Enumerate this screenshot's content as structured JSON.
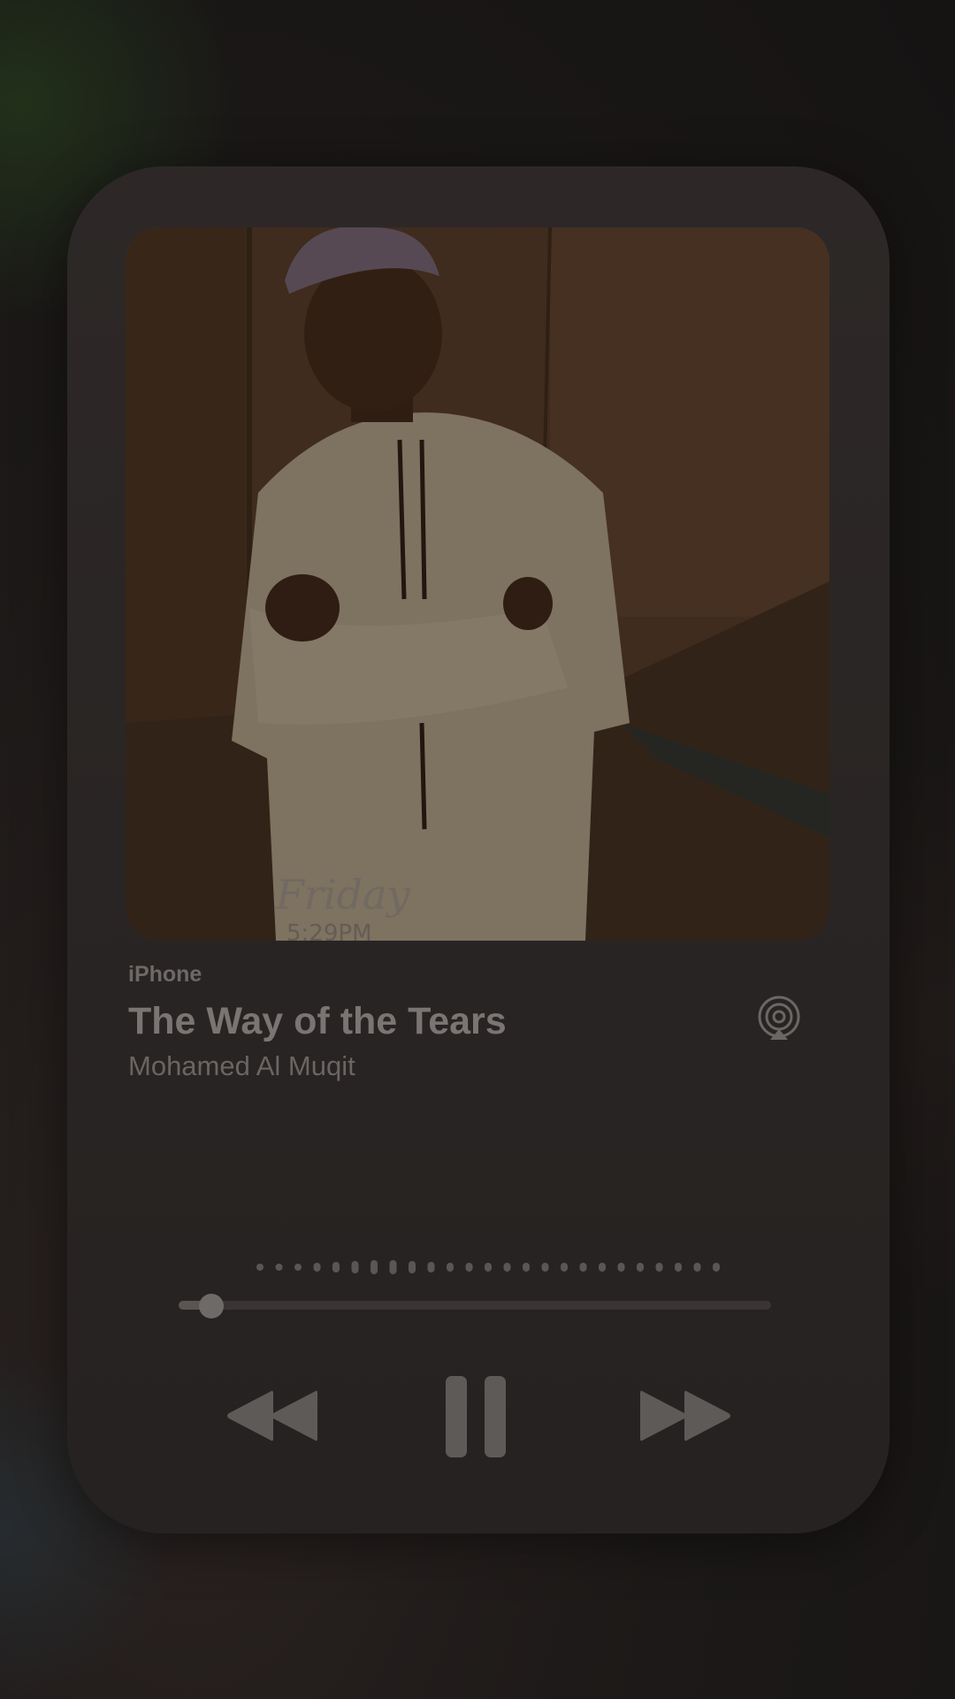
{
  "player": {
    "source": "iPhone",
    "title": "The Way of the Tears",
    "artist": "Mohamed Al Muqit",
    "progress": 0.055,
    "state": "playing"
  },
  "artwork": {
    "watermark_text": "Friday",
    "watermark_time": "5:29PM"
  },
  "icons": {
    "airplay": "airplay-icon",
    "rewind": "rewind-icon",
    "pause": "pause-icon",
    "forward": "fast-forward-icon"
  },
  "colors": {
    "card": "#2a2625",
    "text_primary": "#7a7573",
    "text_secondary": "#6a6562",
    "controls": "#6b6765"
  }
}
